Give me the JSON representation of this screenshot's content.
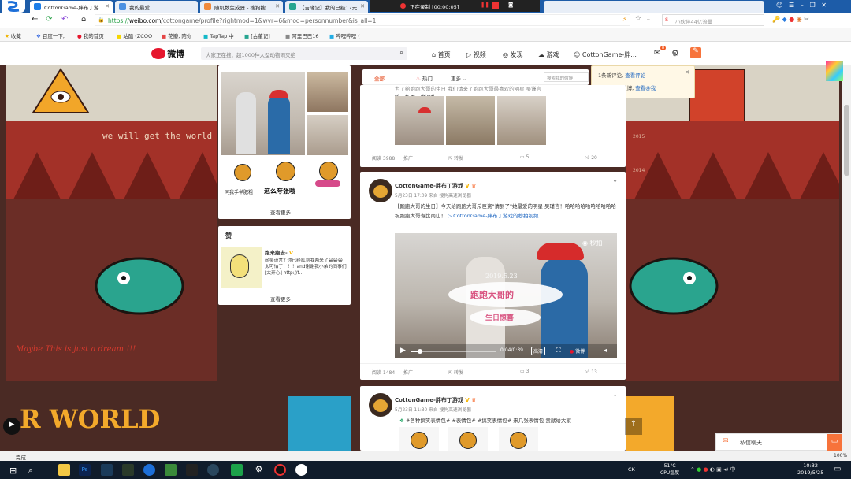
{
  "browser": {
    "tabs": [
      {
        "title": "CottonGame-胖布丁游",
        "active": true,
        "color": "#1d7ee8"
      },
      {
        "title": "我的最爱",
        "active": false,
        "color": "#4a90e2"
      },
      {
        "title": "随机数生成器 - 搜狗搜",
        "active": false,
        "color": "#f08a3c"
      },
      {
        "title": "【吉隆记】我的已经17元",
        "active": false,
        "color": "#27a590"
      }
    ],
    "recording": "正在录制 [00:00:05]",
    "url_scheme": "https://",
    "url_host": "weibo.com",
    "url_path": "/cottongame/profile?rightmod=1&wvr=6&mod=personnumber&is_all=1",
    "search_placeholder": "小伙伴44亿流量",
    "bookmarks": [
      "收藏",
      "百度一下,",
      "我的首页",
      "站酷 (ZCOO",
      "花瓣, 陪你",
      "TapTap 中",
      "[古董记]",
      "阿里巴巴16",
      "哔哩哔哩 ("
    ]
  },
  "weibo": {
    "logo": "微博",
    "search_placeholder": "大家正在搜：超1000种大型动物闹灭绝",
    "nav": [
      "首页",
      "视频",
      "发现",
      "游戏",
      "CottonGame-胖..."
    ],
    "mail_badge": "8",
    "notifications": {
      "line1": "1条新评论,",
      "line1_link": "查看评论",
      "line2": "5条@我的微博,",
      "line2_link": "查看@我"
    }
  },
  "sidebar": {
    "sticker_text": [
      "同我手举肥粗",
      "这么夸张哦"
    ],
    "see_more_1": "查看更多",
    "like_header": "赞",
    "like_user": "跑来跑去-",
    "like_text": "@吴谨言Y 你已经红到我两米了😀😀😀太可怕了！！！and谢谢我小弟的同事们[太开心] http://t...",
    "see_more_2": "查看更多"
  },
  "feed": {
    "filters": [
      "全部",
      "热门",
      "更多"
    ],
    "filter_search": "搜索我的微博",
    "post0": {
      "text_line1": "为了给跑跑大哥的生日 我们请来了跑跑大哥最喜欢的明星 吴谨言",
      "text_line2": "哈，场面一度混乱",
      "reads": "阅读 3988",
      "promote": "推广",
      "repost": "转发",
      "comments": "5",
      "likes": "20"
    },
    "post1": {
      "user": "CottonGame-胖布丁游戏",
      "time": "5月23日 17:09 来自 搜狗高速浏览器",
      "text": "【跑跑大哥的生日】今天给跑跑大哥斥巨资\"请到了\"她最爱的明星 吴瑾言！哈哈哈哈哈哈哈哈哈哈祝跑跑大哥寿比南山！",
      "link": "CottonGame-胖布丁游戏的秒拍视频",
      "video_date": "2019.5.23",
      "video_title_1": "跑跑大哥的",
      "video_title_2": "生日惊喜",
      "video_watermark": "秒拍",
      "video_time": "0:04/0:39",
      "video_quality": "高清",
      "video_brand": "微博",
      "reads": "阅读 1484",
      "promote": "推广",
      "repost": "转发",
      "comments": "3",
      "likes": "13"
    },
    "post2": {
      "user": "CottonGame-胖布丁游戏",
      "time": "5月23日 11:30 来自 搜狗高速浏览器",
      "text": "#各种搞笑表情包# #表情包# #搞笑表情包# 来几张表情包 贡献给大家"
    }
  },
  "background": {
    "text1": "we will get the world",
    "text2": "Maybe This is just a dream !!!",
    "text3": "R WORLD",
    "axis_labels": [
      "2015",
      "2014"
    ]
  },
  "chat": {
    "label": "私信聊天"
  },
  "status": {
    "text": "完成",
    "zoom": "100%"
  },
  "taskbar": {
    "weather_temp": "51°C",
    "weather_label": "CPU温度",
    "ime": "CK",
    "time": "10:32",
    "date": "2019/5/25"
  }
}
